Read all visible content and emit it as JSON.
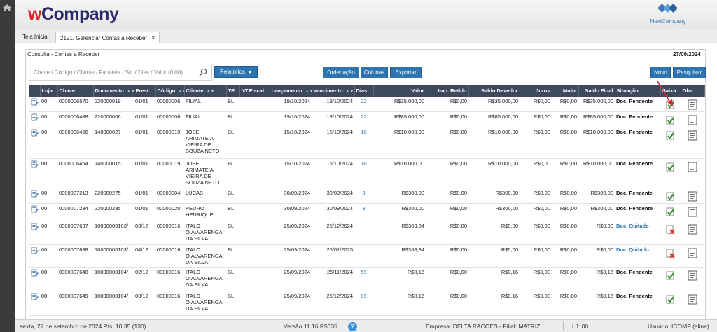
{
  "header": {
    "brand_w": "w",
    "brand_rest": "Company",
    "partner_logo": "NextCompany"
  },
  "tabs": [
    {
      "label": "Tela Inicial"
    },
    {
      "label": "2121. Gerenciar Contas a Receber",
      "close": "×"
    }
  ],
  "panel": {
    "title": "Consulta - Contas a Receber",
    "date": "27/09/2024"
  },
  "toolbar": {
    "search_placeholder": "Chave / Código / Cliente / Fantasia / Sit. / Dias / Valor (0.00)",
    "relatorios": "Relatórios",
    "ordenacao": "Ordenação",
    "colunas": "Colunas",
    "exportar": "Exportar",
    "novo": "Novo",
    "pesquisar": "Pesquisar"
  },
  "columns": [
    "",
    "Loja",
    "Chave",
    "Documento",
    "Prest.",
    "Código",
    "Cliente",
    "TP",
    "NT.Fiscal",
    "Lançamento",
    "Vencimento",
    "Dias",
    "Valor",
    "Imp. Retido",
    "Saldo Devedor",
    "Juros",
    "Multa",
    "Saldo Final",
    "Situação",
    "Baixa",
    "Obs."
  ],
  "rows": [
    {
      "loja": "00",
      "chave": "0000006570",
      "doc": "220000019",
      "prest": "01/01",
      "codigo": "00000006",
      "cliente": "FILIAL",
      "tp": "BL",
      "nf": "",
      "lanc": "19/10/2024",
      "venc": "19/10/2024",
      "dias": "22",
      "valor": "R$35.000,00",
      "imp": "R$0,00",
      "saldo": "R$35.000,00",
      "juros": "R$0,00",
      "multa": "R$0,00",
      "final": "R$35.000,00",
      "sit": "Doc. Pendente",
      "status": "pend"
    },
    {
      "loja": "00",
      "chave": "0000006488",
      "doc": "220000006",
      "prest": "01/01",
      "codigo": "00000006",
      "cliente": "FILIAL",
      "tp": "BL",
      "nf": "",
      "lanc": "19/10/2024",
      "venc": "19/10/2024",
      "dias": "22",
      "valor": "R$85.000,00",
      "imp": "R$0,00",
      "saldo": "R$85.000,00",
      "juros": "R$0,00",
      "multa": "R$0,00",
      "final": "R$85.000,00",
      "sit": "Doc. Pendente",
      "status": "pend"
    },
    {
      "loja": "00",
      "chave": "0000006466",
      "doc": "140000027",
      "prest": "01/01",
      "codigo": "00000019",
      "cliente": "JOSE ARIMATEIA VIEIRA DE SOUZA NETO",
      "tp": "BL",
      "nf": "",
      "lanc": "15/10/2024",
      "venc": "15/10/2024",
      "dias": "18",
      "valor": "R$10.000,00",
      "imp": "R$0,00",
      "saldo": "R$10.000,00",
      "juros": "R$0,00",
      "multa": "R$0,00",
      "final": "R$10.000,00",
      "sit": "Doc. Pendente",
      "status": "pend"
    },
    {
      "loja": "00",
      "chave": "0000006454",
      "doc": "140000015",
      "prest": "01/01",
      "codigo": "00000019",
      "cliente": "JOSE ARIMATEIA VIEIRA DE SOUZA NETO",
      "tp": "BL",
      "nf": "",
      "lanc": "15/10/2024",
      "venc": "15/10/2024",
      "dias": "18",
      "valor": "R$10.000,00",
      "imp": "R$0,00",
      "saldo": "R$10.000,00",
      "juros": "R$0,00",
      "multa": "R$0,00",
      "final": "R$10.000,00",
      "sit": "Doc. Pendente",
      "status": "pend"
    },
    {
      "loja": "00",
      "chave": "0000007213",
      "doc": "220000275",
      "prest": "01/01",
      "codigo": "00000004",
      "cliente": "LUCAS",
      "tp": "BL",
      "nf": "",
      "lanc": "30/09/2024",
      "venc": "30/09/2024",
      "dias": "3",
      "valor": "R$300,00",
      "imp": "R$0,00",
      "saldo": "R$300,00",
      "juros": "R$0,00",
      "multa": "R$0,00",
      "final": "R$300,00",
      "sit": "Doc. Pendente",
      "status": "pend"
    },
    {
      "loja": "00",
      "chave": "0000007234",
      "doc": "220000285",
      "prest": "01/01",
      "codigo": "00000020",
      "cliente": "PEDRO HENRIQUE",
      "tp": "BL",
      "nf": "",
      "lanc": "30/09/2024",
      "venc": "30/09/2024",
      "dias": "3",
      "valor": "R$300,00",
      "imp": "R$0,00",
      "saldo": "R$300,00",
      "juros": "R$0,00",
      "multa": "R$0,00",
      "final": "R$300,00",
      "sit": "Doc. Pendente",
      "status": "pend"
    },
    {
      "loja": "00",
      "chave": "0000007637",
      "doc": "10000000103/",
      "prest": "03/12",
      "codigo": "00000016",
      "cliente": "ITALO O.ALVARENGA DA SILVA",
      "tp": "BL",
      "nf": "",
      "lanc": "25/09/2024",
      "venc": "25/12/2024",
      "dias": "",
      "valor": "R$368,34",
      "imp": "R$0,00",
      "saldo": "R$0,00",
      "juros": "R$0,00",
      "multa": "R$0,00",
      "final": "R$0,00",
      "sit": "Doc. Quitado",
      "status": "quit"
    },
    {
      "loja": "00",
      "chave": "0000007638",
      "doc": "10000000103/",
      "prest": "04/12",
      "codigo": "00000016",
      "cliente": "ITALO O.ALVARENGA DA SILVA",
      "tp": "BL",
      "nf": "",
      "lanc": "25/09/2024",
      "venc": "25/01/2025",
      "dias": "",
      "valor": "R$368,34",
      "imp": "R$0,00",
      "saldo": "R$0,00",
      "juros": "R$0,00",
      "multa": "R$0,00",
      "final": "R$0,00",
      "sit": "Doc. Quitado",
      "status": "quit"
    },
    {
      "loja": "00",
      "chave": "0000007648",
      "doc": "10000000104/",
      "prest": "02/12",
      "codigo": "00000016",
      "cliente": "ITALO O.ALVARENGA DA SILVA",
      "tp": "BL",
      "nf": "",
      "lanc": "25/09/2024",
      "venc": "25/11/2024",
      "dias": "59",
      "valor": "R$0,16",
      "imp": "R$0,00",
      "saldo": "R$0,16",
      "juros": "R$0,00",
      "multa": "R$0,00",
      "final": "R$0,16",
      "sit": "Doc. Pendente",
      "status": "pend"
    },
    {
      "loja": "00",
      "chave": "0000007649",
      "doc": "10000000104/",
      "prest": "03/12",
      "codigo": "00000016",
      "cliente": "ITALO O.ALVARENGA DA SILVA",
      "tp": "BL",
      "nf": "",
      "lanc": "25/09/2024",
      "venc": "25/12/2024",
      "dias": "89",
      "valor": "R$0,16",
      "imp": "R$0,00",
      "saldo": "R$0,16",
      "juros": "R$0,00",
      "multa": "R$0,00",
      "final": "R$0,16",
      "sit": "Doc. Pendente",
      "status": "pend"
    }
  ],
  "footer": {
    "date_rfs": "sexta, 27 de setembro de 2024  Rfs: 10:35 (130)",
    "version": "Versão 11.16.R5035",
    "help": "?",
    "empresa": "Empresa: DELTA RACOES - Filial: MATRIZ",
    "lj": "LJ: 00",
    "usuario": "Usuário: ICOMP (aline)"
  },
  "colors": {
    "accent": "#2d74b0",
    "header_dark": "#3e4a5c",
    "brand_red": "#e2262e",
    "brand_navy": "#2c2a6b",
    "ok_green": "#2e8b2e",
    "cancel_red": "#d9242b"
  }
}
